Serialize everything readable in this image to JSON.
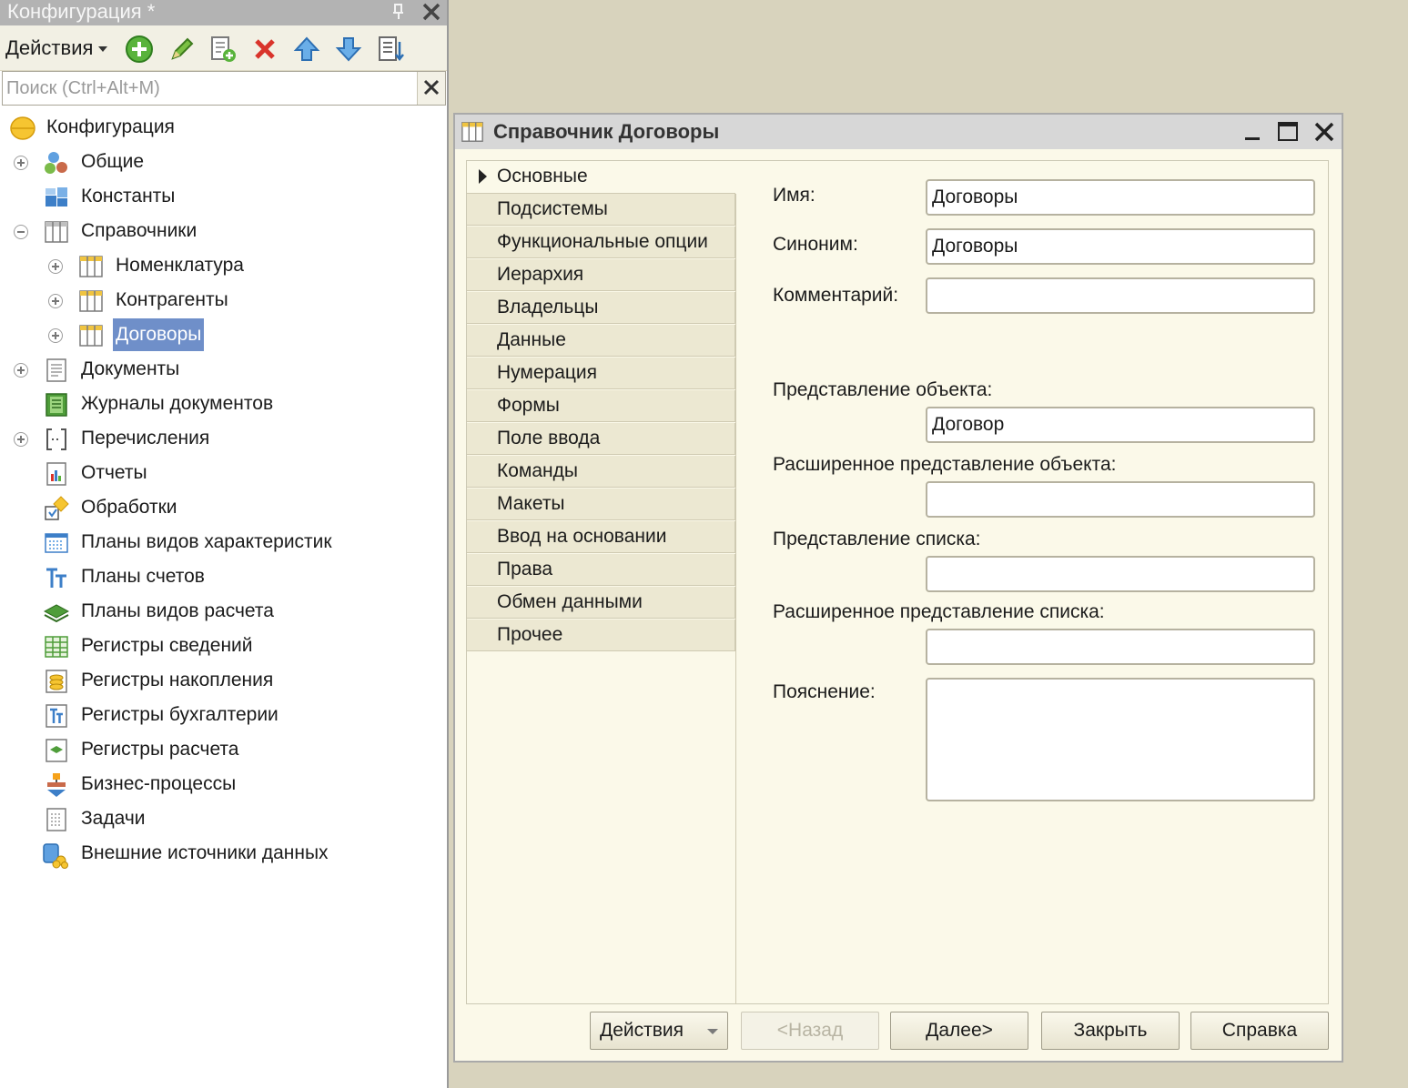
{
  "config_panel": {
    "title": "Конфигурация *",
    "actions_label": "Действия",
    "search_placeholder": "Поиск (Ctrl+Alt+M)",
    "tree": [
      {
        "label": "Конфигурация",
        "icon": "configuration-icon"
      },
      {
        "label": "Общие",
        "icon": "common-icon",
        "expander": "plus"
      },
      {
        "label": "Константы",
        "icon": "constants-icon"
      },
      {
        "label": "Справочники",
        "icon": "catalog-icon",
        "expander": "minus"
      },
      {
        "label": "Номенклатура",
        "icon": "catalog-icon",
        "expander": "plus"
      },
      {
        "label": "Контрагенты",
        "icon": "catalog-icon",
        "expander": "plus"
      },
      {
        "label": "Договоры",
        "icon": "catalog-icon",
        "expander": "plus",
        "selected": true
      },
      {
        "label": "Документы",
        "icon": "document-icon",
        "expander": "plus"
      },
      {
        "label": "Журналы документов",
        "icon": "journal-icon"
      },
      {
        "label": "Перечисления",
        "icon": "enum-icon",
        "expander": "plus"
      },
      {
        "label": "Отчеты",
        "icon": "report-icon"
      },
      {
        "label": "Обработки",
        "icon": "dataprocessor-icon"
      },
      {
        "label": "Планы видов характеристик",
        "icon": "chart-of-characteristics-icon"
      },
      {
        "label": "Планы счетов",
        "icon": "chart-of-accounts-icon"
      },
      {
        "label": "Планы видов расчета",
        "icon": "chart-of-calculation-icon"
      },
      {
        "label": "Регистры сведений",
        "icon": "info-register-icon"
      },
      {
        "label": "Регистры накопления",
        "icon": "accumulation-register-icon"
      },
      {
        "label": "Регистры бухгалтерии",
        "icon": "accounting-register-icon"
      },
      {
        "label": "Регистры расчета",
        "icon": "calculation-register-icon"
      },
      {
        "label": "Бизнес-процессы",
        "icon": "business-process-icon"
      },
      {
        "label": "Задачи",
        "icon": "task-icon"
      },
      {
        "label": "Внешние источники данных",
        "icon": "external-datasource-icon"
      }
    ]
  },
  "form": {
    "title": "Справочник Договоры",
    "tabs": [
      {
        "label": "Основные",
        "active": true
      },
      {
        "label": "Подсистемы"
      },
      {
        "label": "Функциональные опции"
      },
      {
        "label": "Иерархия"
      },
      {
        "label": "Владельцы"
      },
      {
        "label": "Данные"
      },
      {
        "label": "Нумерация"
      },
      {
        "label": "Формы"
      },
      {
        "label": "Поле ввода"
      },
      {
        "label": "Команды"
      },
      {
        "label": "Макеты"
      },
      {
        "label": "Ввод на основании"
      },
      {
        "label": "Права"
      },
      {
        "label": "Обмен данными"
      },
      {
        "label": "Прочее"
      }
    ],
    "fields": {
      "name_label": "Имя:",
      "name_value": "Договоры",
      "synonym_label": "Синоним:",
      "synonym_value": "Договоры",
      "comment_label": "Комментарий:",
      "comment_value": "",
      "object_presentation_label": "Представление объекта:",
      "object_presentation_value": "Договор",
      "ext_object_presentation_label": "Расширенное представление объекта:",
      "ext_object_presentation_value": "",
      "list_presentation_label": "Представление списка:",
      "list_presentation_value": "",
      "ext_list_presentation_label": "Расширенное представление списка:",
      "ext_list_presentation_value": "",
      "explanation_label": "Пояснение:",
      "explanation_value": ""
    },
    "buttons": {
      "actions": "Действия",
      "back": "<Назад",
      "next": "Далее>",
      "close": "Закрыть",
      "help": "Справка"
    }
  }
}
